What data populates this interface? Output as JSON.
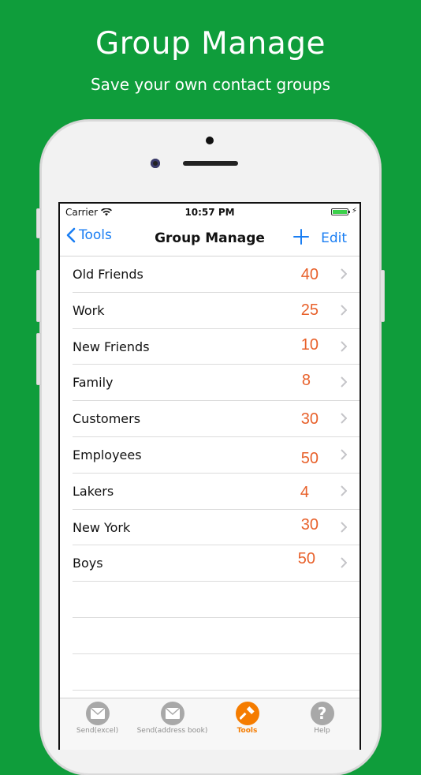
{
  "promo": {
    "title": "Group Manage",
    "subtitle": "Save your own contact groups"
  },
  "status_bar": {
    "carrier": "Carrier",
    "time": "10:57 PM"
  },
  "nav": {
    "back_label": "Tools",
    "title": "Group Manage",
    "edit_label": "Edit"
  },
  "groups": [
    {
      "name": "Old Friends",
      "count": "40"
    },
    {
      "name": "Work",
      "count": "25"
    },
    {
      "name": "New Friends",
      "count": "10"
    },
    {
      "name": "Family",
      "count": "8"
    },
    {
      "name": "Customers",
      "count": "30"
    },
    {
      "name": "Employees",
      "count": "50"
    },
    {
      "name": "Lakers",
      "count": "4"
    },
    {
      "name": "New York",
      "count": "30"
    },
    {
      "name": "Boys",
      "count": "50"
    }
  ],
  "tabs": [
    {
      "label": "Send(excel)",
      "icon": "envelope-icon"
    },
    {
      "label": "Send(address book)",
      "icon": "envelope-icon"
    },
    {
      "label": "Tools",
      "icon": "hammer-icon"
    },
    {
      "label": "Help",
      "icon": "question-icon"
    }
  ],
  "colors": {
    "background": "#0f9d3b",
    "accent_blue": "#1a7ef3",
    "count_orange": "#e8612b",
    "active_tab": "#f57c00"
  }
}
